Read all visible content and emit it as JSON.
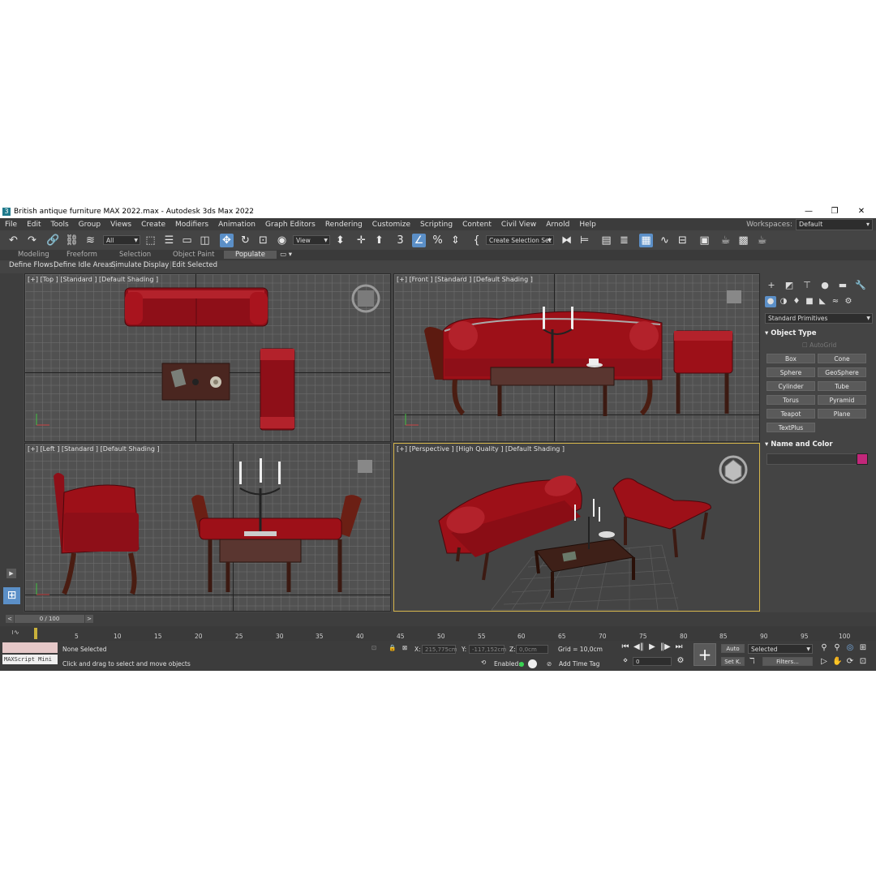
{
  "window": {
    "title": "British antique furniture MAX 2022.max - Autodesk 3ds Max 2022",
    "logo": "3"
  },
  "window_controls": {
    "minimize": "—",
    "maximize": "❐",
    "close": "✕"
  },
  "menu": [
    "File",
    "Edit",
    "Tools",
    "Group",
    "Views",
    "Create",
    "Modifiers",
    "Animation",
    "Graph Editors",
    "Rendering",
    "Customize",
    "Scripting",
    "Content",
    "Civil View",
    "Arnold",
    "Help"
  ],
  "workspaces": {
    "label": "Workspaces:",
    "value": "Default"
  },
  "toolbar": {
    "filter_value": "All",
    "refcoord_value": "View",
    "snap_label": "3",
    "selection_set_placeholder": "Create Selection Set"
  },
  "ribbon_tabs": [
    "Modeling",
    "Freeform",
    "Selection",
    "Object Paint",
    "Populate"
  ],
  "ribbon_active": "Populate",
  "ribbon_buttons": [
    "Define Flows",
    "Define Idle Areas",
    "Simulate",
    "Display",
    "Edit Selected"
  ],
  "viewports": {
    "top": "[+] [Top ] [Standard ] [Default Shading ]",
    "front": "[+] [Front ] [Standard ] [Default Shading ]",
    "left": "[+] [Left ] [Standard ] [Default Shading ]",
    "perspective": "[+] [Perspective ] [High Quality ] [Default Shading ]"
  },
  "command_panel": {
    "category": "Standard Primitives",
    "object_type_header": "Object Type",
    "autogrid": "AutoGrid",
    "buttons": [
      "Box",
      "Cone",
      "Sphere",
      "GeoSphere",
      "Cylinder",
      "Tube",
      "Torus",
      "Pyramid",
      "Teapot",
      "Plane",
      "TextPlus"
    ],
    "name_color_header": "Name and Color",
    "color_swatch": "#c2277a"
  },
  "timeline": {
    "frame_display": "0 / 100",
    "ticks": [
      "5",
      "10",
      "15",
      "20",
      "25",
      "30",
      "35",
      "40",
      "45",
      "50",
      "55",
      "60",
      "65",
      "70",
      "75",
      "80",
      "85",
      "90",
      "95",
      "100"
    ]
  },
  "status": {
    "script_label": "MAXScript Mini",
    "selection": "None Selected",
    "prompt": "Click and drag to select and move objects",
    "x_label": "X:",
    "x_value": "215,775cm",
    "y_label": "Y:",
    "y_value": "-117,152cm",
    "z_label": "Z:",
    "z_value": "0,0cm",
    "grid": "Grid = 10,0cm",
    "enabled_label": "Enabled:",
    "add_time_tag": "Add Time Tag",
    "auto": "Auto",
    "selected": "Selected",
    "setk": "Set K.",
    "filters": "Filters...",
    "frame_value": "0"
  },
  "colors": {
    "accent": "#5b8fc7",
    "viewport_border_active": "#d6b64b",
    "sofa_red": "#a5121c",
    "wood": "#4a1d12"
  }
}
